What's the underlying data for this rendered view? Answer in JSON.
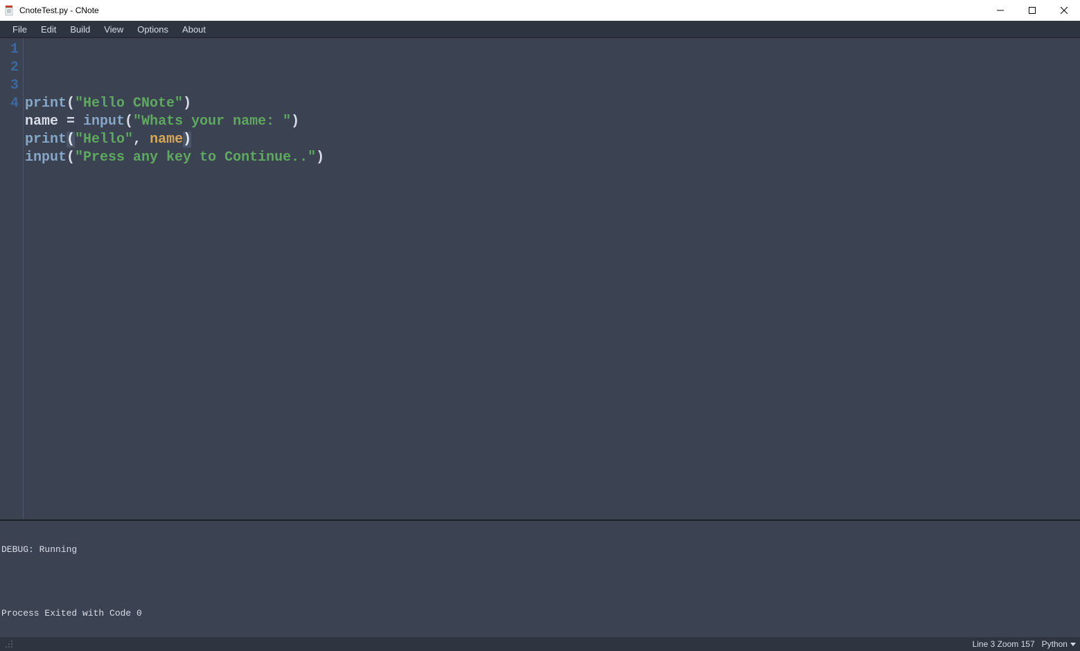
{
  "window": {
    "title": "CnoteTest.py - CNote"
  },
  "menu": {
    "items": [
      "File",
      "Edit",
      "Build",
      "View",
      "Options",
      "About"
    ]
  },
  "editor": {
    "line_numbers": [
      "1",
      "2",
      "3",
      "4"
    ],
    "lines": [
      {
        "tokens": [
          {
            "t": "print",
            "cls": "tok-func"
          },
          {
            "t": "(",
            "cls": "tok-par"
          },
          {
            "t": "\"Hello CNote\"",
            "cls": "tok-str"
          },
          {
            "t": ")",
            "cls": "tok-par"
          }
        ]
      },
      {
        "tokens": [
          {
            "t": "name ",
            "cls": "tok-id"
          },
          {
            "t": "= ",
            "cls": "tok-op"
          },
          {
            "t": "input",
            "cls": "tok-func"
          },
          {
            "t": "(",
            "cls": "tok-par"
          },
          {
            "t": "\"Whats your name: \"",
            "cls": "tok-str"
          },
          {
            "t": ")",
            "cls": "tok-par"
          }
        ]
      },
      {
        "tokens": [
          {
            "t": "print",
            "cls": "tok-func"
          },
          {
            "t": "(",
            "cls": "tok-par-hl"
          },
          {
            "t": "\"Hello\"",
            "cls": "tok-str"
          },
          {
            "t": ", ",
            "cls": "tok-par"
          },
          {
            "t": "name",
            "cls": "tok-arg"
          },
          {
            "t": ")",
            "cls": "tok-par-hl"
          }
        ]
      },
      {
        "tokens": [
          {
            "t": "input",
            "cls": "tok-func"
          },
          {
            "t": "(",
            "cls": "tok-par"
          },
          {
            "t": "\"Press any key to Continue..\"",
            "cls": "tok-str"
          },
          {
            "t": ")",
            "cls": "tok-par"
          }
        ]
      }
    ]
  },
  "console": {
    "lines": [
      "DEBUG: Running",
      "",
      "Process Exited with Code 0"
    ]
  },
  "status": {
    "line_info": "Line 3 Zoom 157",
    "language": "Python"
  }
}
